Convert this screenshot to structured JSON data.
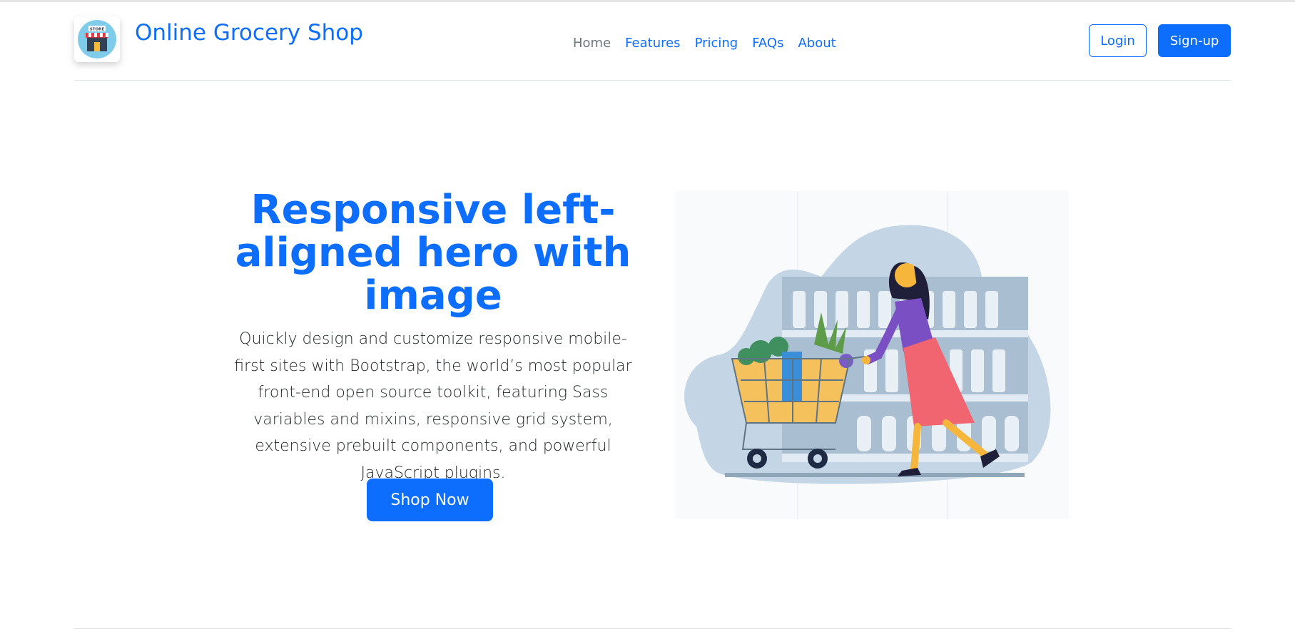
{
  "header": {
    "brand_name": "Online Grocery Shop",
    "logo_sign_text": "STORE",
    "nav": [
      {
        "label": "Home",
        "active": true
      },
      {
        "label": "Features",
        "active": false
      },
      {
        "label": "Pricing",
        "active": false
      },
      {
        "label": "FAQs",
        "active": false
      },
      {
        "label": "About",
        "active": false
      }
    ],
    "login_label": "Login",
    "signup_label": "Sign-up"
  },
  "hero": {
    "title": "Responsive left-aligned hero with image",
    "description": "Quickly design and customize responsive mobile-first sites with Bootstrap, the world’s most popular front-end open source toolkit, featuring Sass variables and mixins, responsive grid system, extensive prebuilt components, and powerful JavaScript plugins.",
    "cta_label": "Shop Now",
    "image_icon": "woman-pushing-shopping-cart-illustration"
  },
  "colors": {
    "primary": "#0d6efd",
    "muted_nav": "#6c757d",
    "body_text": "#212529",
    "border": "#dee2e6"
  }
}
